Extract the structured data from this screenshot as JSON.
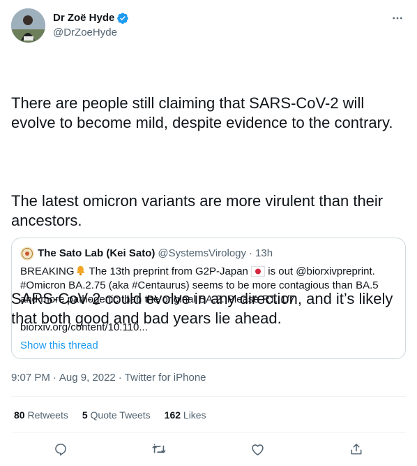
{
  "author": {
    "name": "Dr Zoë Hyde",
    "handle": "@DrZoeHyde",
    "verified": true
  },
  "tweet": {
    "paragraphs": [
      "There are people still claiming that SARS-CoV-2 will evolve to become mild, despite evidence to the contrary.",
      "The latest omicron variants are more virulent than their ancestors.",
      "SARS-CoV-2 could evolve in any direction, and it’s likely that both good and bad years lie ahead."
    ],
    "time": "9:07 PM",
    "date": "Aug 9, 2022",
    "source": "Twitter for iPhone",
    "separator": "·"
  },
  "quote": {
    "name": "The Sato Lab (Kei Sato)",
    "handle": "@SystemsVirology",
    "time": "13h",
    "line1_a": "BREAKING",
    "line1_b": " The 13th preprint from G2P-Japan",
    "line1_c": " is out @biorxivpreprint.",
    "line2": "#Omicron BA.2.75 (aka #Centaurus) seems to be more contagious than BA.5 and more pathogenic than the original BA.2. Please RT. 1/7",
    "link": "biorxiv.org/content/10.110...",
    "show_thread": "Show this thread"
  },
  "stats": {
    "retweets_count": "80",
    "retweets_label": "Retweets",
    "quotes_count": "5",
    "quotes_label": "Quote Tweets",
    "likes_count": "162",
    "likes_label": "Likes"
  },
  "icons": [
    "verified-badge-icon",
    "more-icon",
    "reply-icon",
    "retweet-icon",
    "like-icon",
    "share-icon",
    "bell-emoji-icon",
    "japan-flag-emoji-icon"
  ],
  "colors": {
    "accent": "#1d9bf0",
    "muted": "#536471",
    "text": "#0f1419",
    "border": "#cfd9de"
  }
}
